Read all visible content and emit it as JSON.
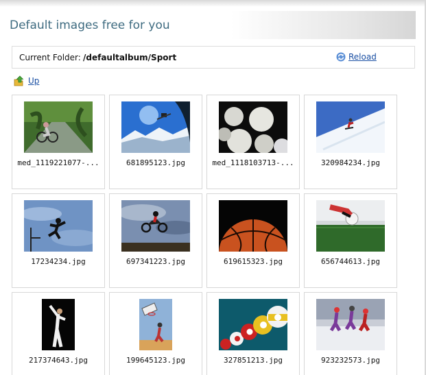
{
  "header": {
    "title": "Default images free for you"
  },
  "folder": {
    "label": "Current Folder:",
    "path": "/defaultalbum/Sport",
    "reload_label": "Reload"
  },
  "nav": {
    "up_label": "Up"
  },
  "images": [
    {
      "name": "med_1119221077-...",
      "subject": "cyclist-on-forest-road"
    },
    {
      "name": "681895123.jpg",
      "subject": "ski-jumper-over-mountains"
    },
    {
      "name": "med_1118103713-...",
      "subject": "golf-balls"
    },
    {
      "name": "320984234.jpg",
      "subject": "snowboarder-on-slope"
    },
    {
      "name": "17234234.jpg",
      "subject": "rugby-player-leaping"
    },
    {
      "name": "697341223.jpg",
      "subject": "motocross-jump"
    },
    {
      "name": "619615323.jpg",
      "subject": "basketball"
    },
    {
      "name": "656744613.jpg",
      "subject": "soccer-ball-kick"
    },
    {
      "name": "217374643.jpg",
      "subject": "karate-kick"
    },
    {
      "name": "199645123.jpg",
      "subject": "basketball-hoop-dunk"
    },
    {
      "name": "327851213.jpg",
      "subject": "billiard-balls"
    },
    {
      "name": "923232573.jpg",
      "subject": "ice-hockey-players"
    }
  ]
}
